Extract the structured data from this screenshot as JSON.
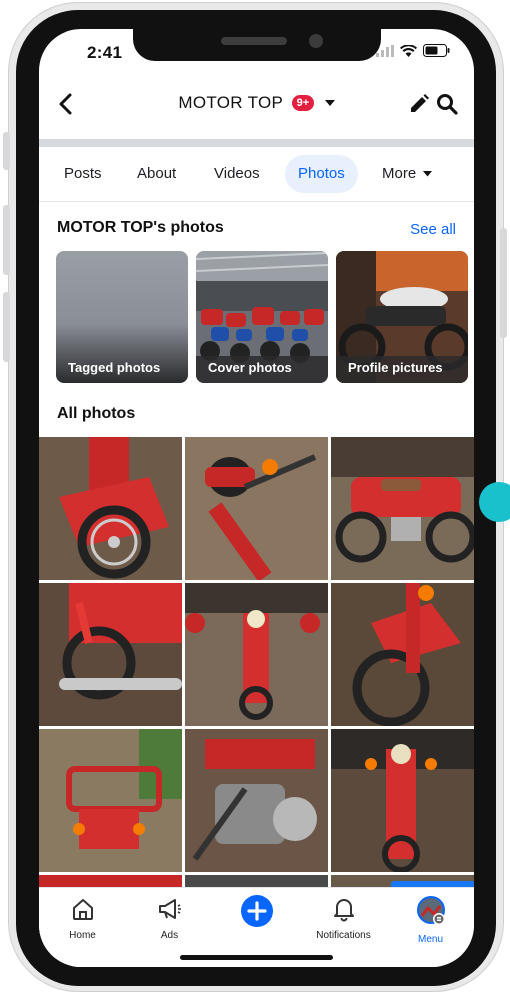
{
  "status_bar": {
    "time": "2:41"
  },
  "header": {
    "title": "MOTOR TOP",
    "badge": "9+"
  },
  "tabs": [
    {
      "label": "Posts"
    },
    {
      "label": "About"
    },
    {
      "label": "Videos"
    },
    {
      "label": "Photos",
      "active": true
    },
    {
      "label": "More"
    }
  ],
  "photos_section": {
    "title": "MOTOR TOP's photos",
    "see_all": "See all",
    "albums": [
      {
        "label": "Tagged photos"
      },
      {
        "label": "Cover photos"
      },
      {
        "label": "Profile pictures"
      }
    ]
  },
  "all_photos": {
    "title": "All photos"
  },
  "bottom_nav": [
    {
      "label": "Home",
      "icon": "home-icon"
    },
    {
      "label": "Ads",
      "icon": "megaphone-icon"
    },
    {
      "label": "",
      "icon": "plus-icon"
    },
    {
      "label": "Notifications",
      "icon": "bell-icon"
    },
    {
      "label": "Menu",
      "icon": "avatar-menu-icon",
      "active": true
    }
  ],
  "colors": {
    "accent": "#0866ff",
    "badge": "#e41e3f",
    "bike_red": "#d62828"
  }
}
